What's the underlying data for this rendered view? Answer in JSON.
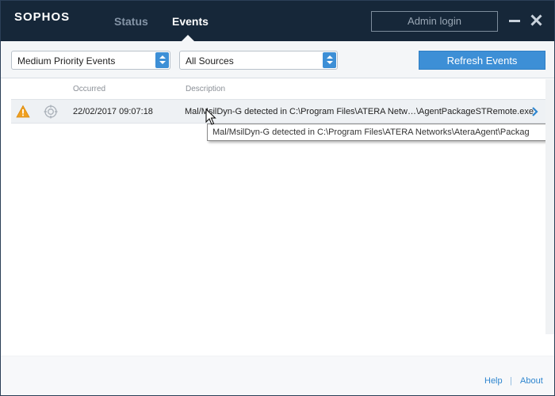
{
  "header": {
    "logo": "SOPHOS",
    "tabs": [
      {
        "label": "Status",
        "active": false
      },
      {
        "label": "Events",
        "active": true
      }
    ],
    "admin_login": "Admin login"
  },
  "toolbar": {
    "priority_filter": "Medium Priority Events",
    "source_filter": "All Sources",
    "refresh_label": "Refresh Events"
  },
  "columns": {
    "occurred": "Occurred",
    "description": "Description"
  },
  "events": [
    {
      "severity": "warning-icon",
      "source_icon": "target-icon",
      "occurred": "22/02/2017 09:07:18",
      "description": "Mal/MsilDyn-G detected in C:\\Program Files\\ATERA Netw…\\AgentPackageSTRemote.exe"
    }
  ],
  "tooltip": "Mal/MsilDyn-G detected in C:\\Program Files\\ATERA Networks\\AteraAgent\\Packag",
  "footer": {
    "help": "Help",
    "separator": "|",
    "about": "About"
  },
  "colors": {
    "header_bg": "#162739",
    "accent_blue": "#3d8fd6",
    "warning": "#f0a020"
  }
}
